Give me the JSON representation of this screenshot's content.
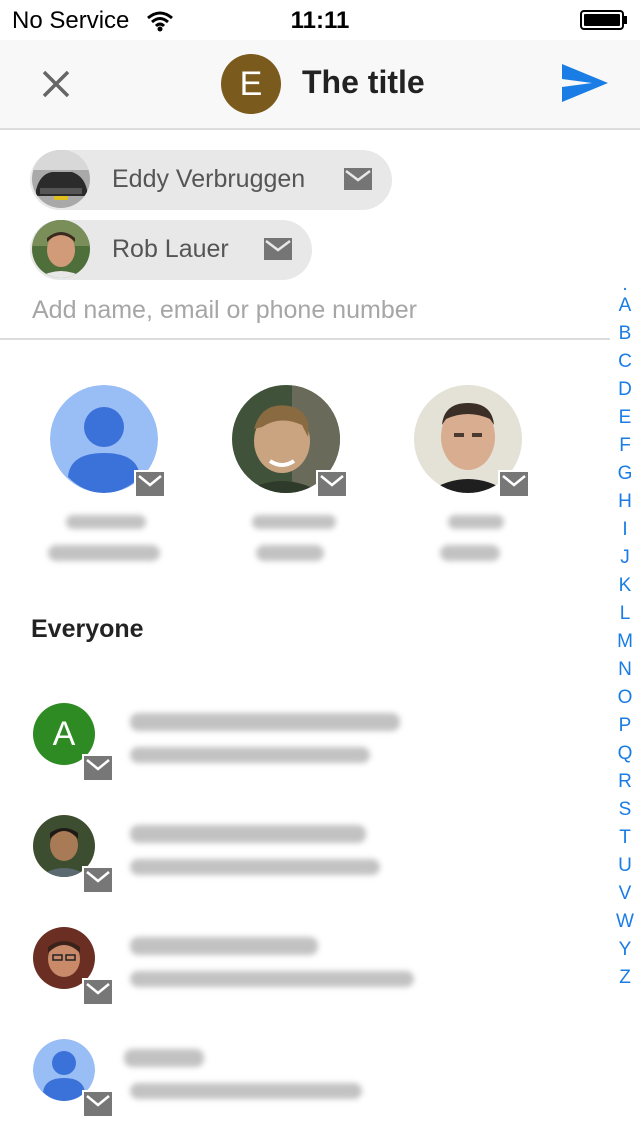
{
  "status_bar": {
    "carrier": "No Service",
    "time": "11:11"
  },
  "header": {
    "avatar_letter": "E",
    "title": "The title"
  },
  "recipients": [
    {
      "name": "Eddy Verbruggen"
    },
    {
      "name": "Rob Lauer"
    }
  ],
  "search": {
    "placeholder": "Add name, email or phone number"
  },
  "section": {
    "everyone_label": "Everyone"
  },
  "contacts": [
    {
      "avatar_letter": "A"
    }
  ],
  "alphabet_index": [
    ".",
    "A",
    "B",
    "C",
    "D",
    "E",
    "F",
    "G",
    "H",
    "I",
    "J",
    "K",
    "L",
    "M",
    "N",
    "O",
    "P",
    "Q",
    "R",
    "S",
    "T",
    "U",
    "V",
    "W",
    "Y",
    "Z"
  ],
  "colors": {
    "accent": "#1a7de6",
    "title_avatar": "#7b5a1e",
    "contact_avatar_green": "#2e8b23",
    "chip_bg": "#e8e8e8"
  },
  "icons": [
    "close-icon",
    "send-icon",
    "mail-icon",
    "wifi-icon",
    "battery-icon",
    "default-person-icon"
  ]
}
